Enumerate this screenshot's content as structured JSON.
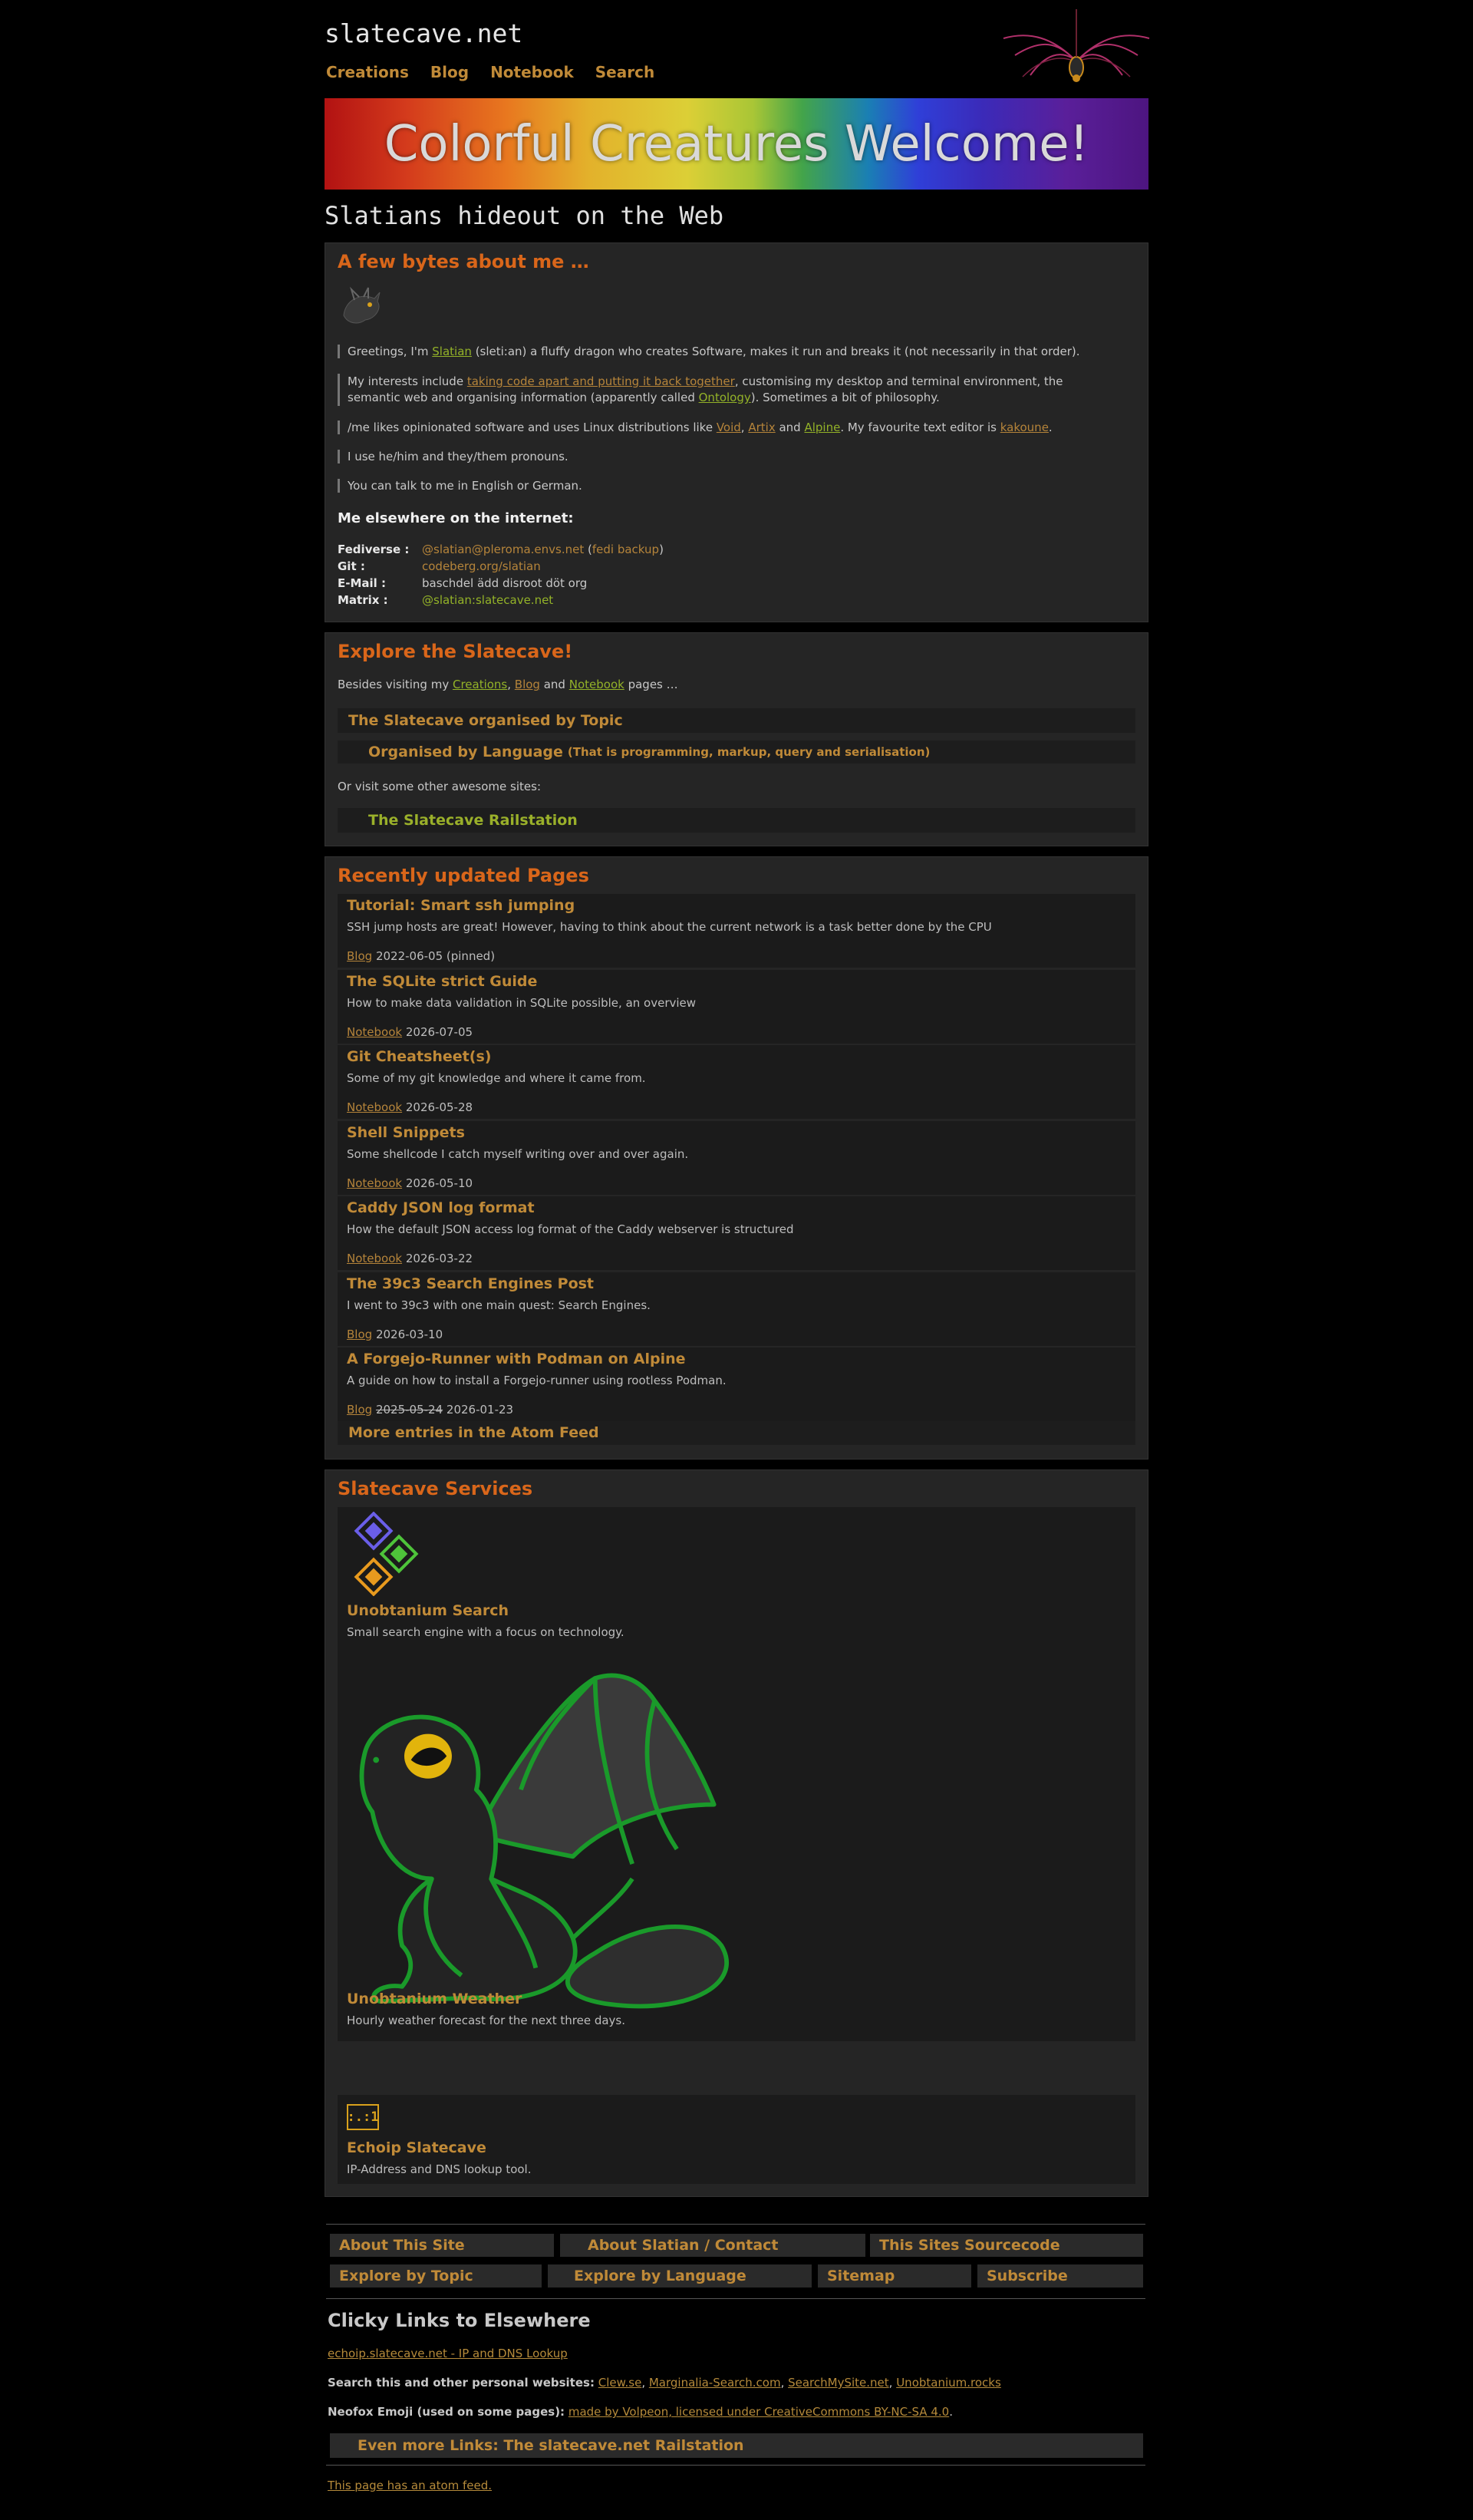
{
  "site": {
    "title": "slatecave.net",
    "nav": [
      "Creations",
      "Blog",
      "Notebook",
      "Search"
    ],
    "banner": "Colorful Creatures Welcome!",
    "tagline": "Slatians hideout on the Web"
  },
  "about": {
    "heading": "A few bytes about me …",
    "p1": {
      "a": "Greetings, I'm ",
      "link": "Slatian",
      "b": " (sleti:an) a fluffy dragon who creates Software, makes it run and breaks it (not necessarily in that order)."
    },
    "p2": {
      "a": "My interests include ",
      "link1": "taking code apart and putting it back together",
      "b": ", customising my desktop and terminal environment, the",
      "c": "semantic web and organising information (apparently called ",
      "link2": "Ontology",
      "d": "). Sometimes a bit of philosophy."
    },
    "p3": {
      "a": "/me likes opinionated software and uses Linux distributions like ",
      "l1": "Void",
      "s1": ", ",
      "l2": "Artix",
      "s2": " and ",
      "l3": "Alpine",
      "b": ". My favourite text editor is ",
      "l4": "kakoune",
      "c": "."
    },
    "p4": "I use he/him and they/them pronouns.",
    "p5": "You can talk to me in English or German.",
    "elsewhere_heading": "Me elsewhere on the internet:",
    "contacts": [
      {
        "label": "Fediverse :",
        "value": "@slatian@pleroma.envs.net",
        "extra_open": " (",
        "extra": "fedi backup",
        "extra_close": ")"
      },
      {
        "label": "Git :",
        "value": "codeberg.org/slatian"
      },
      {
        "label": "E-Mail :",
        "value": "baschdel ädd disroot döt org"
      },
      {
        "label": "Matrix :",
        "value": "@slatian:slatecave.net"
      }
    ]
  },
  "explore": {
    "heading": "Explore the Slatecave!",
    "intro": {
      "a": "Besides visiting my ",
      "l1": "Creations",
      "s1": ", ",
      "l2": "Blog",
      "s2": " and ",
      "l3": "Notebook",
      "b": " pages …"
    },
    "topic": "The Slatecave organised by Topic",
    "language": "Organised by Language",
    "language_note": "(That is programming, markup, query and serialisation)",
    "other": "Or visit some other awesome sites:",
    "railstation": "The Slatecave Railstation"
  },
  "recent": {
    "heading": "Recently updated Pages",
    "items": [
      {
        "title": "Tutorial: Smart ssh jumping",
        "desc": "SSH jump hosts are great! However, having to think about the current network is a task better done by the CPU",
        "section": "Blog",
        "old_date": "",
        "date": "2022-06-05 (pinned)"
      },
      {
        "title": "The SQLite strict Guide",
        "desc": "How to make data validation in SQLite possible, an overview",
        "section": "Notebook",
        "old_date": "",
        "date": "2026-07-05"
      },
      {
        "title": "Git Cheatsheet(s)",
        "desc": "Some of my git knowledge and where it came from.",
        "section": "Notebook",
        "old_date": "",
        "date": "2026-05-28"
      },
      {
        "title": "Shell Snippets",
        "desc": "Some shellcode I catch myself writing over and over again.",
        "section": "Notebook",
        "old_date": "",
        "date": "2026-05-10"
      },
      {
        "title": "Caddy JSON log format",
        "desc": "How the default JSON access log format of the Caddy webserver is structured",
        "section": "Notebook",
        "old_date": "",
        "date": "2026-03-22"
      },
      {
        "title": "The 39c3 Search Engines Post",
        "desc": "I went to 39c3 with one main quest: Search Engines.",
        "section": "Blog",
        "old_date": "",
        "date": "2026-03-10"
      },
      {
        "title": "A Forgejo-Runner with Podman on Alpine",
        "desc": "A guide on how to install a Forgejo-runner using rootless Podman.",
        "section": "Blog",
        "old_date": "2025-05-24",
        "date": "2026-01-23"
      }
    ],
    "more": "More entries in the Atom Feed"
  },
  "services": {
    "heading": "Slatecave Services",
    "items": [
      {
        "title": "Unobtanium Search",
        "desc": "Small search engine with a focus on technology."
      },
      {
        "title": "Unobtanium Weather",
        "desc": "Hourly weather forecast for the next three days."
      },
      {
        "title": "Echoip Slatecave",
        "desc": "IP-Address and DNS lookup tool.",
        "icon_text": ":.:1"
      }
    ]
  },
  "footer": {
    "row1": [
      "About This Site",
      "About Slatian / Contact",
      "This Sites Sourcecode"
    ],
    "row2": [
      "Explore by Topic",
      "Explore by Language",
      "Sitemap",
      "Subscribe"
    ],
    "clicky_heading": "Clicky Links to Elsewhere",
    "echoip": "echoip.slatecave.net - IP and DNS Lookup",
    "search_label": "Search this and other personal websites:",
    "search_links": [
      "Clew.se",
      "Marginalia-Search.com",
      "SearchMySite.net",
      "Unobtanium.rocks"
    ],
    "emoji_label": "Neofox Emoji (used on some pages):",
    "emoji_link": "made by Volpeon, licensed under CreativeCommons BY-NC-SA 4.0",
    "railstation": "Even more Links: The slatecave.net Railstation",
    "atom": "This page has an atom feed."
  },
  "colors": {
    "accent_orange": "#d9661a",
    "link_gold": "#c08a38",
    "link_green": "#93b228",
    "panel": "#252525",
    "card": "#1b1b1b"
  },
  "icons": [
    "dragon-logo-icon",
    "avatar-dragon-icon",
    "unobtanium-diamonds-icon",
    "frog-dragon-icon",
    "echoip-terminal-icon"
  ]
}
